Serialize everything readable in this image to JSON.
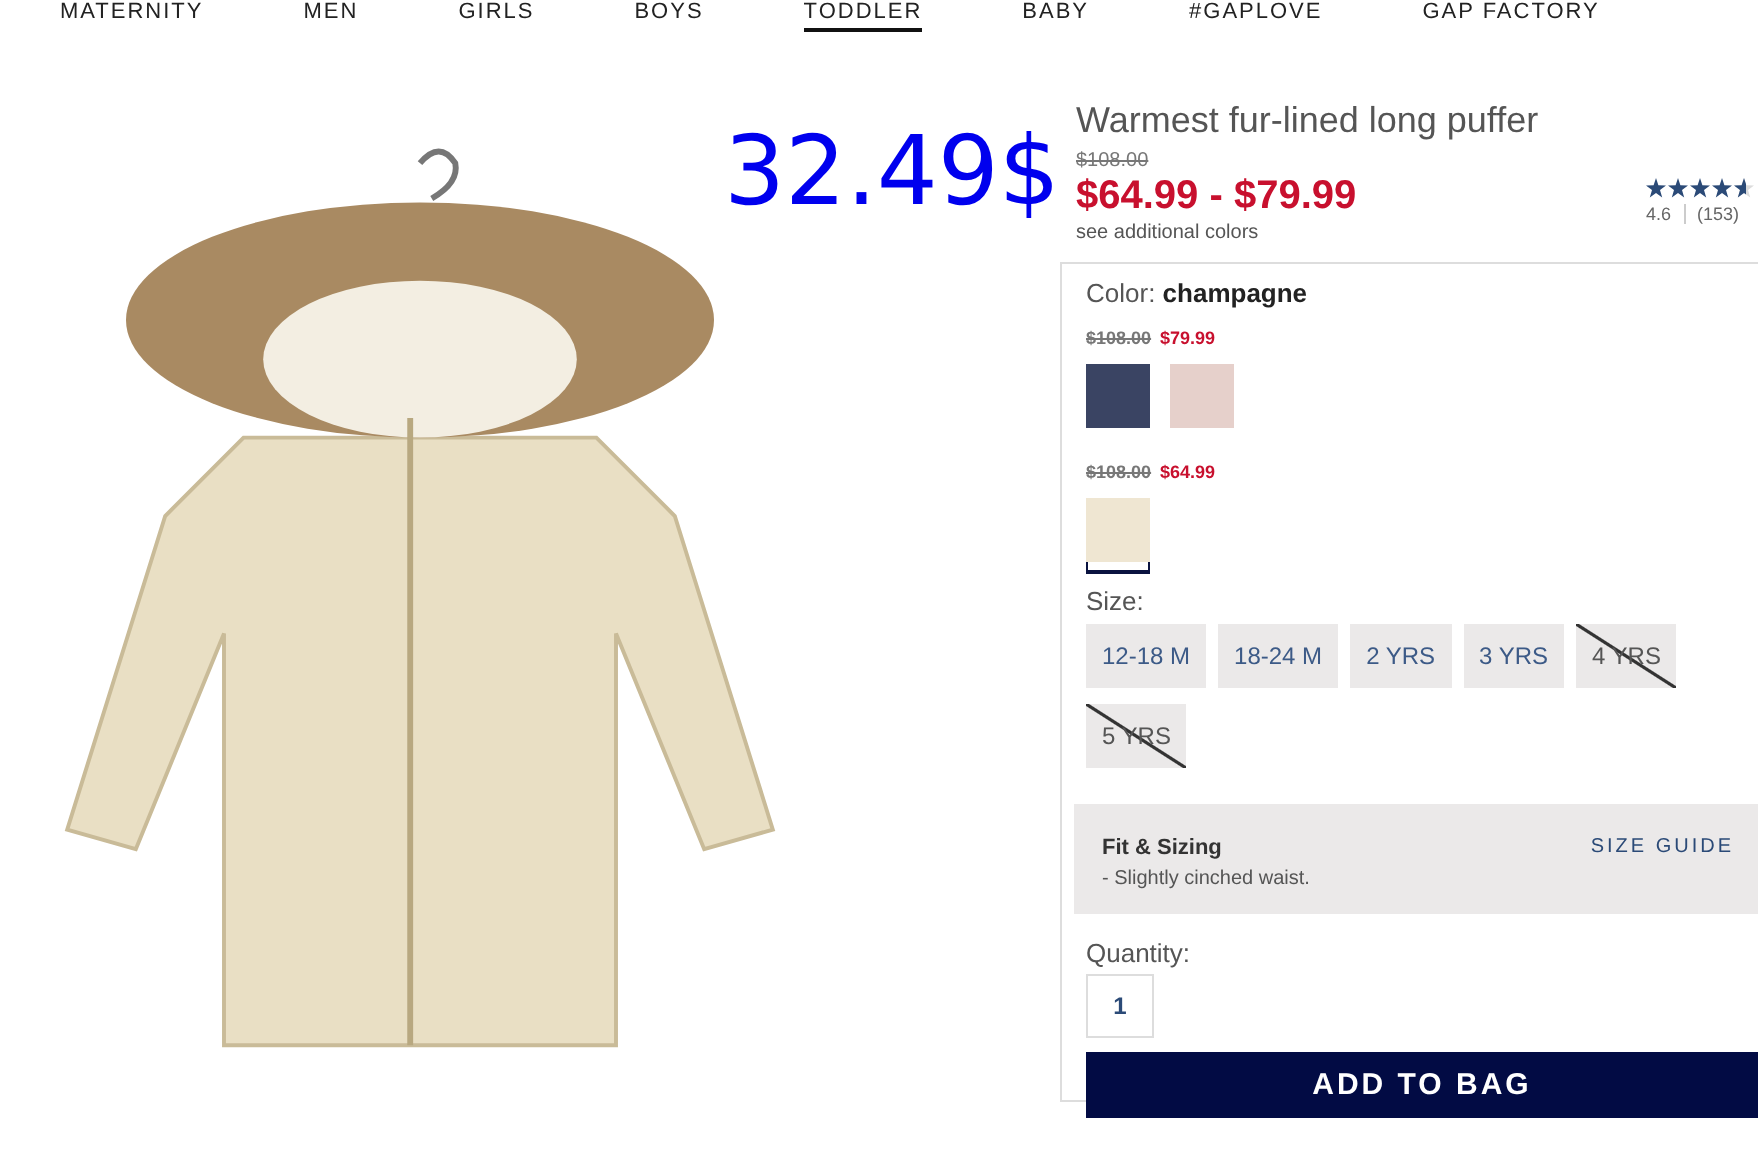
{
  "nav": [
    {
      "label": "MATERNITY",
      "selected": false
    },
    {
      "label": "MEN",
      "selected": false
    },
    {
      "label": "GIRLS",
      "selected": false
    },
    {
      "label": "BOYS",
      "selected": false
    },
    {
      "label": "TODDLER",
      "selected": true
    },
    {
      "label": "BABY",
      "selected": false
    },
    {
      "label": "#GAPLOVE",
      "selected": false
    },
    {
      "label": "GAP FACTORY",
      "selected": false
    }
  ],
  "annotation": "32.49$",
  "product": {
    "title": "Warmest fur-lined long puffer",
    "original_price": "$108.00",
    "price": "$64.99 - $79.99",
    "more_colors": "see additional colors",
    "rating": {
      "stars": 4.6,
      "score": "4.6",
      "count": "(153)"
    }
  },
  "color": {
    "label": "Color:",
    "value": "champagne",
    "groups": [
      {
        "original_price": "$108.00",
        "price": "$79.99",
        "swatches": [
          {
            "color": "#3a4463",
            "selected": false
          },
          {
            "color": "#e6d0cb",
            "selected": false
          }
        ]
      },
      {
        "original_price": "$108.00",
        "price": "$64.99",
        "swatches": [
          {
            "color": "#efe6d2",
            "selected": true
          }
        ]
      }
    ]
  },
  "size": {
    "label": "Size:",
    "options": [
      {
        "label": "12-18 M",
        "disabled": false
      },
      {
        "label": "18-24 M",
        "disabled": false
      },
      {
        "label": "2 YRS",
        "disabled": false
      },
      {
        "label": "3 YRS",
        "disabled": false
      },
      {
        "label": "4 YRS",
        "disabled": true
      },
      {
        "label": "5 YRS",
        "disabled": true
      }
    ]
  },
  "fit": {
    "title": "Fit & Sizing",
    "link": "SIZE GUIDE",
    "note": "- Slightly cinched waist."
  },
  "quantity": {
    "label": "Quantity:",
    "value": "1"
  },
  "add_button": "ADD TO BAG"
}
